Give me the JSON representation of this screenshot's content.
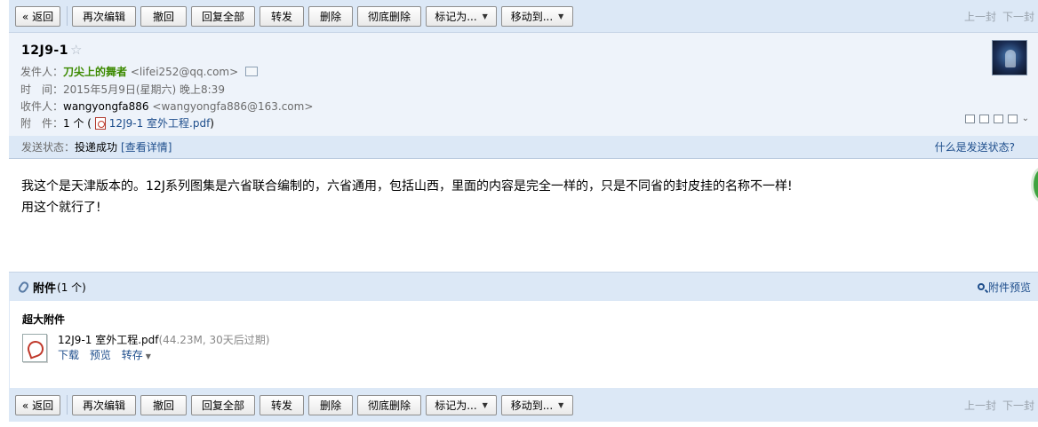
{
  "toolbar": {
    "back": "« 返回",
    "edit_again": "再次编辑",
    "recall": "撤回",
    "reply_all": "回复全部",
    "forward": "转发",
    "delete": "删除",
    "delete_permanently": "彻底删除",
    "mark_as": "标记为...",
    "move_to": "移动到...",
    "prev": "上一封",
    "next": "下一封"
  },
  "email": {
    "subject": "12J9-1",
    "from_label": "发件人：",
    "from_name": "刀尖上的舞者",
    "from_email": "<lifei252@qq.com>",
    "time_label": "时　间：",
    "time_value": "2015年5月9日(星期六) 晚上8:39",
    "to_label": "收件人：",
    "to_name": "wangyongfa886",
    "to_email": "<wangyongfa886@163.com>",
    "attach_label": "附　件：",
    "attach_count_open": "1 个 (",
    "attach_file": "12J9-1 室外工程.pdf",
    "attach_close": ")"
  },
  "status": {
    "label": "发送状态：",
    "value": "投递成功",
    "details": "[查看详情]",
    "help": "什么是发送状态?"
  },
  "body": {
    "line1": "我这个是天津版本的。12J系列图集是六省联合编制的，六省通用，包括山西，里面的内容是完全一样的，只是不同省的封皮挂的名称不一样!",
    "line2": "用这个就行了!"
  },
  "attachments": {
    "title": "附件",
    "count": "(1 个)",
    "preview_link": "附件预览",
    "big_label": "超大附件",
    "file_name": "12J9-1 室外工程.pdf",
    "file_meta": "(44.23M, 30天后过期)",
    "download": "下载",
    "preview": "预览",
    "save_to": "转存"
  },
  "icons": {
    "star": "star-icon",
    "contact_card": "contact-card-icon",
    "pdf": "pdf-icon",
    "paperclip": "paperclip-icon",
    "search": "search-icon"
  },
  "colors": {
    "toolbar_bg": "#dce8f6",
    "header_bg": "#eef3fa",
    "sender_green": "#3c8a00",
    "link_blue": "#1e4e8c"
  }
}
